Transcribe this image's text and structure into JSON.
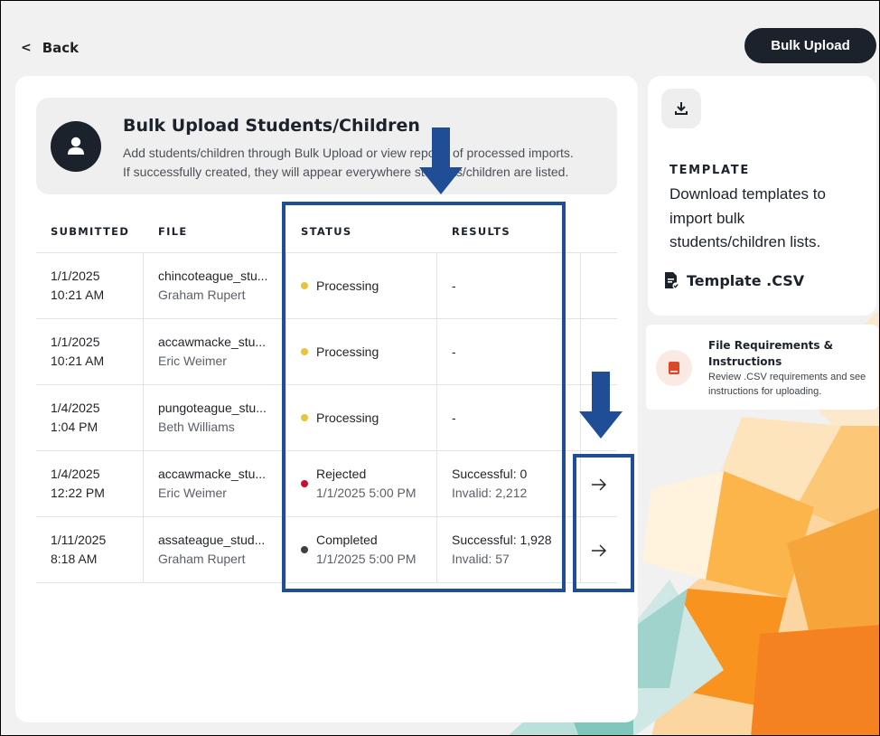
{
  "header": {
    "back_label": "Back",
    "bulk_upload_label": "Bulk Upload"
  },
  "banner": {
    "title": "Bulk Upload Students/Children",
    "description_line1": "Add students/children through Bulk Upload or view reports of processed imports.",
    "description_line2": "If successfully created, they will appear everywhere students/children are listed."
  },
  "table": {
    "columns": [
      "SUBMITTED",
      "FILE",
      "STATUS",
      "RESULTS"
    ],
    "rows": [
      {
        "date": "1/1/2025",
        "time": "10:21 AM",
        "file": "chincoteague_stu...",
        "user": "Graham Rupert",
        "status": "Processing",
        "status_color": "#e8c33b",
        "status_date": "",
        "result1": "-",
        "result2": "",
        "has_arrow": false
      },
      {
        "date": "1/1/2025",
        "time": "10:21 AM",
        "file": "accawmacke_stu...",
        "user": "Eric Weimer",
        "status": "Processing",
        "status_color": "#e8c33b",
        "status_date": "",
        "result1": "-",
        "result2": "",
        "has_arrow": false
      },
      {
        "date": "1/4/2025",
        "time": "1:04 PM",
        "file": "pungoteague_stu...",
        "user": "Beth Williams",
        "status": "Processing",
        "status_color": "#e8c33b",
        "status_date": "",
        "result1": "-",
        "result2": "",
        "has_arrow": false
      },
      {
        "date": "1/4/2025",
        "time": "12:22 PM",
        "file": "accawmacke_stu...",
        "user": "Eric Weimer",
        "status": "Rejected",
        "status_color": "#c8102e",
        "status_date": "1/1/2025 5:00 PM",
        "result1": "Successful: 0",
        "result2": "Invalid: 2,212",
        "has_arrow": true
      },
      {
        "date": "1/11/2025",
        "time": "8:18 AM",
        "file": "assateague_stud...",
        "user": "Graham Rupert",
        "status": "Completed",
        "status_color": "#3d3f44",
        "status_date": "1/1/2025 5:00 PM",
        "result1": "Successful: 1,928",
        "result2": "Invalid: 57",
        "has_arrow": true
      }
    ]
  },
  "template": {
    "label": "TEMPLATE",
    "description": "Download templates to import bulk students/children lists.",
    "link_label": "Template .CSV"
  },
  "requirements": {
    "title": "File Requirements & Instructions",
    "description": "Review .CSV requirements and see instructions for uploading."
  },
  "colors": {
    "dark": "#1c222b",
    "highlight": "#1f4e96",
    "processing": "#e8c33b",
    "rejected": "#c8102e",
    "completed": "#3d3f44",
    "accent_orange": "#f7931e"
  },
  "icons": {
    "back": "chevron-left-icon",
    "avatar": "user-icon",
    "download": "download-icon",
    "template_file": "file-csv-icon",
    "requirements": "book-icon",
    "row_action": "arrow-right-icon",
    "annotation": "down-arrow-marker-icon"
  }
}
